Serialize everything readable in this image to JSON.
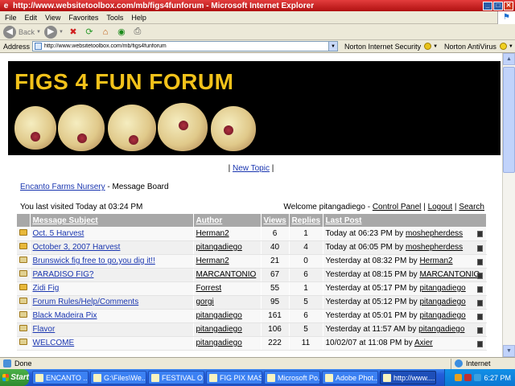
{
  "window": {
    "title": "http://www.websitetoolbox.com/mb/figs4funforum - Microsoft Internet Explorer"
  },
  "menu": [
    "File",
    "Edit",
    "View",
    "Favorites",
    "Tools",
    "Help"
  ],
  "toolbar": {
    "back_label": "Back"
  },
  "address": {
    "label": "Address",
    "value": "http://www.websitetoolbox.com/mb/figs4funforum",
    "norton_security": "Norton Internet Security",
    "norton_antivirus": "Norton AntiVirus"
  },
  "banner": {
    "title": "FIGS 4 FUN FORUM"
  },
  "nav": {
    "sep_left": "|",
    "new_topic": "New Topic",
    "sep_right": "|"
  },
  "breadcrumb": {
    "link": "Encanto Farms Nursery",
    "rest": " - Message Board"
  },
  "visit": {
    "last_visited": "You last visited Today at 03:24 PM",
    "welcome": "Welcome pitangadiego - ",
    "control_panel": "Control Panel",
    "logout": "Logout",
    "search": "Search"
  },
  "table": {
    "headers": {
      "subject": "Message Subject",
      "author": "Author",
      "views": "Views",
      "replies": "Replies",
      "last_post": "Last Post"
    },
    "rows": [
      {
        "subject": "Oct. 5 Harvest",
        "author": "Herman2",
        "views": "6",
        "replies": "1",
        "last_time": "Today at 06:23 PM by ",
        "last_by": "moshepherdess",
        "new": true
      },
      {
        "subject": "October 3, 2007 Harvest",
        "author": "pitangadiego",
        "views": "40",
        "replies": "4",
        "last_time": "Today at 06:05 PM by ",
        "last_by": "moshepherdess",
        "new": true
      },
      {
        "subject": "Brunswick fig free to go,you dig it!!",
        "author": "Herman2",
        "views": "21",
        "replies": "0",
        "last_time": "Yesterday at 08:32 PM by ",
        "last_by": "Herman2",
        "new": false
      },
      {
        "subject": "PARADISO FIG?",
        "author": "MARCANTONIO",
        "views": "67",
        "replies": "6",
        "last_time": "Yesterday at 08:15 PM by ",
        "last_by": "MARCANTONIO",
        "new": false
      },
      {
        "subject": "Zidi Fig",
        "author": "Forrest",
        "views": "55",
        "replies": "1",
        "last_time": "Yesterday at 05:17 PM by ",
        "last_by": "pitangadiego",
        "new": true
      },
      {
        "subject": "Forum Rules/Help/Comments",
        "author": "gorgi",
        "views": "95",
        "replies": "5",
        "last_time": "Yesterday at 05:12 PM by ",
        "last_by": "pitangadiego",
        "new": false
      },
      {
        "subject": "Black Madeira Pix",
        "author": "pitangadiego",
        "views": "161",
        "replies": "6",
        "last_time": "Yesterday at 05:01 PM by ",
        "last_by": "pitangadiego",
        "new": false
      },
      {
        "subject": "Flavor",
        "author": "pitangadiego",
        "views": "106",
        "replies": "5",
        "last_time": "Yesterday at 11:57 AM by ",
        "last_by": "pitangadiego",
        "new": false
      },
      {
        "subject": "WELCOME",
        "author": "pitangadiego",
        "views": "222",
        "replies": "11",
        "last_time": "10/02/07 at 11:08 PM by ",
        "last_by": "Axier",
        "new": false
      }
    ]
  },
  "status": {
    "left": "Done",
    "zone": "Internet"
  },
  "taskbar": {
    "start": "Start",
    "tasks": [
      "ENCANTO ...",
      "G:\\Files\\We...",
      "FESTIVAL O...",
      "FIG PIX MAS...",
      "Microsoft Po...",
      "Adobe Phot...",
      "http://www...."
    ],
    "clock": "6:27 PM"
  },
  "icons": {
    "folder_new_color": "#e8b83a",
    "banner_text_color": "#f2c21a"
  }
}
